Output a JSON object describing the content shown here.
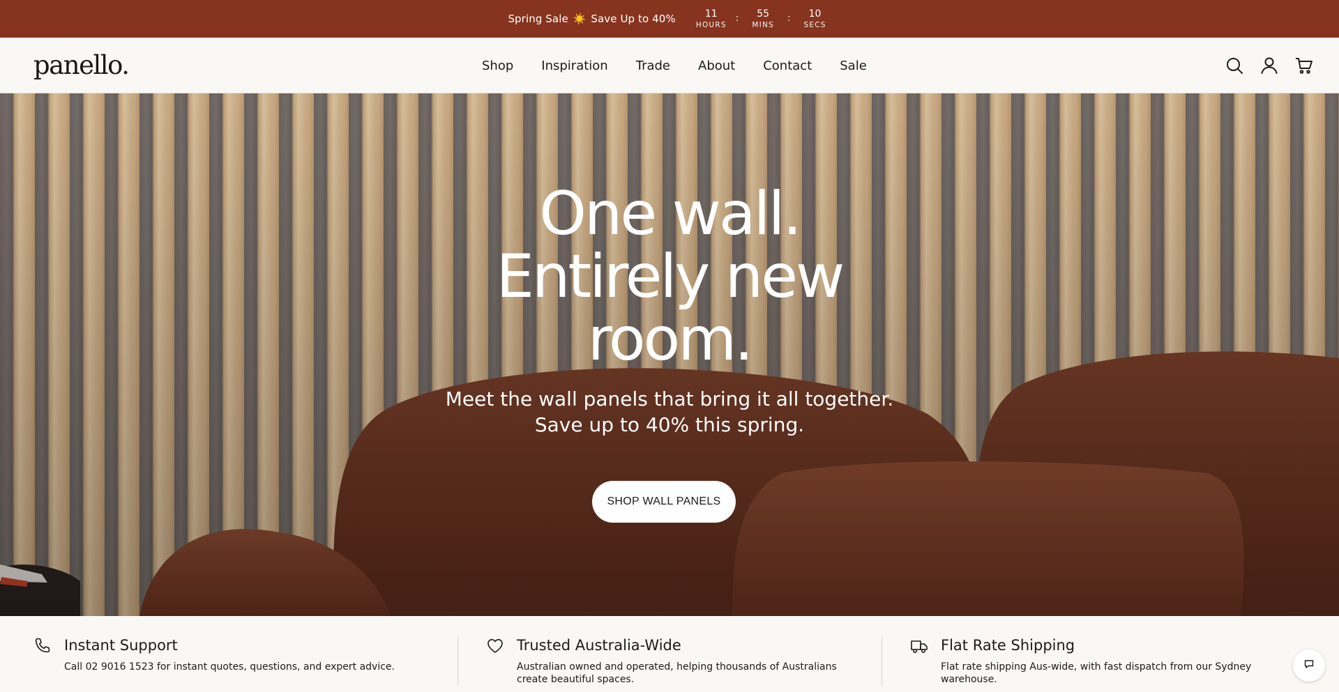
{
  "announcement": {
    "promo_text": "Spring Sale",
    "promo_icon": "☀️",
    "promo_rest": "Save Up to 40%",
    "countdown": [
      {
        "value": "11",
        "label": "HOURS"
      },
      {
        "value": "55",
        "label": "MINS"
      },
      {
        "value": "10",
        "label": "SECS"
      }
    ],
    "separator": ":",
    "bg_color": "#86341f"
  },
  "header": {
    "logo": "panello.",
    "nav": [
      "Shop",
      "Inspiration",
      "Trade",
      "About",
      "Contact",
      "Sale"
    ],
    "icons": [
      "search-icon",
      "account-icon",
      "cart-icon"
    ]
  },
  "hero": {
    "title_lines": [
      "One wall.",
      "Entirely new",
      "room."
    ],
    "subtitle_lines": [
      "Meet the wall panels that bring it all together.",
      "Save up to 40% this spring."
    ],
    "cta_label": "SHOP WALL PANELS"
  },
  "features": [
    {
      "icon": "phone-icon",
      "title": "Instant Support",
      "description": "Call 02 9016 1523 for instant quotes, questions, and expert advice."
    },
    {
      "icon": "heart-icon",
      "title": "Trusted Australia-Wide",
      "description": "Australian owned and operated, helping thousands of Australians create beautiful spaces."
    },
    {
      "icon": "truck-icon",
      "title": "Flat Rate Shipping",
      "description": "Flat rate shipping Aus-wide, with fast dispatch from our Sydney warehouse."
    }
  ],
  "chat": {
    "icon": "chat-icon"
  }
}
